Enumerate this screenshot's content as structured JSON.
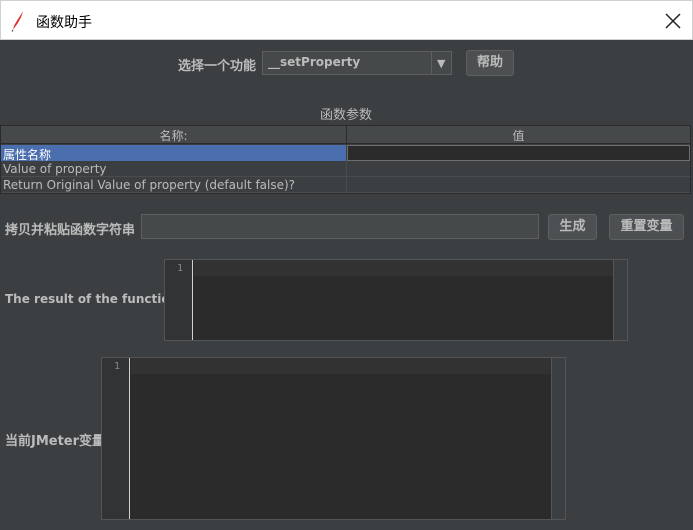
{
  "window": {
    "title": "函数助手",
    "icon": "feather-icon",
    "close_icon": "close-icon"
  },
  "selector": {
    "label": "选择一个功能",
    "selected_function": "__setProperty",
    "help_label": "帮助"
  },
  "params": {
    "title": "函数参数",
    "columns": [
      "名称:",
      "值"
    ],
    "rows": [
      {
        "name": "属性名称",
        "value": ""
      },
      {
        "name": "Value of property",
        "value": ""
      },
      {
        "name": "Return Original Value of property (default false)?",
        "value": ""
      }
    ]
  },
  "function_string": {
    "label": "拷贝并粘贴函数字符串",
    "value": "",
    "generate_label": "生成",
    "reset_label": "重置变量"
  },
  "result": {
    "label": "The result of the function is",
    "line_number": "1"
  },
  "jmeter_vars": {
    "label": "当前JMeter变量",
    "line_number": "1"
  },
  "colors": {
    "background": "#3c3f41",
    "selection": "#4b6eaf",
    "editor_bg": "#2b2b2b"
  }
}
